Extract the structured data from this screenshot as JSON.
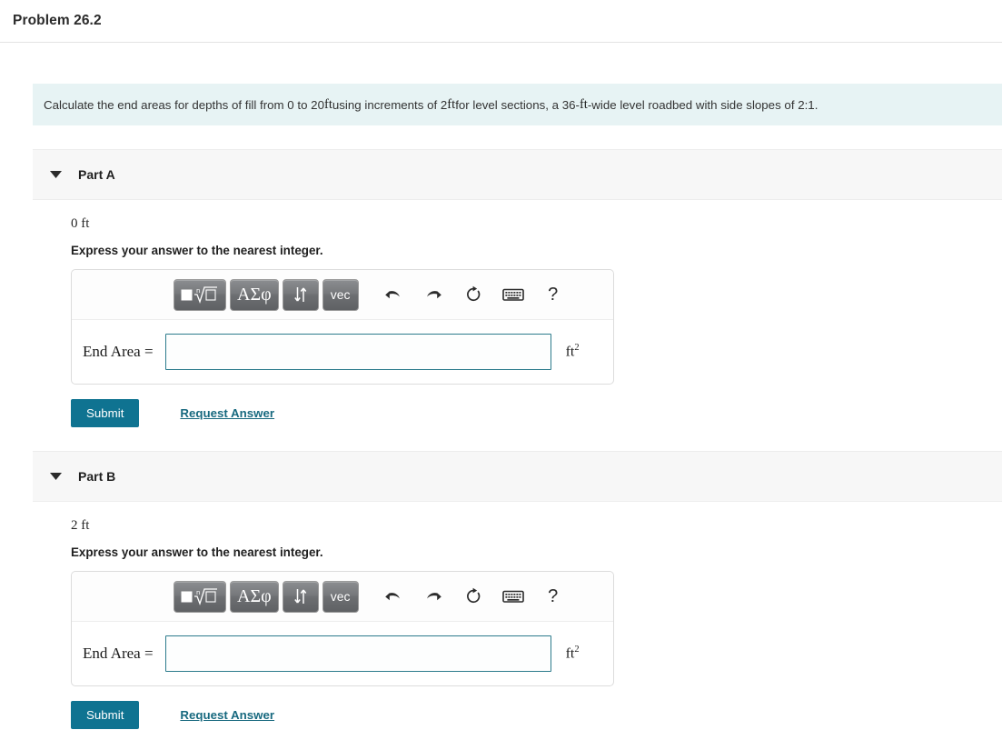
{
  "header": {
    "title": "Problem 26.2"
  },
  "statement": {
    "seg1": "Calculate the end areas for depths of fill from 0 to 20 ",
    "unit1": "ft",
    "seg2": " using increments of 2 ",
    "unit2": "ft",
    "seg3": " for level sections, a 36-",
    "unit3": "ft",
    "seg4": "-wide level roadbed with side slopes of 2:1."
  },
  "toolbar": {
    "template_button": "template-radical",
    "greek_label": "ΑΣφ",
    "arrows_label": "↕",
    "vec_label": "vec",
    "undo_icon": "undo-icon",
    "redo_icon": "redo-icon",
    "reset_icon": "reset-icon",
    "keyboard_icon": "keyboard-icon",
    "help_label": "?"
  },
  "answer": {
    "equation_label": "End Area =",
    "input_value": "",
    "input_placeholder": "",
    "unit_base": "ft",
    "unit_exp": "2"
  },
  "actions": {
    "submit_label": "Submit",
    "request_label": "Request Answer"
  },
  "parts": [
    {
      "label": "Part A",
      "caret": "caret-down-icon",
      "depth": "0 ft",
      "instruction": "Express your answer to the nearest integer."
    },
    {
      "label": "Part B",
      "caret": "caret-down-icon",
      "depth": "2 ft",
      "instruction": "Express your answer to the nearest integer."
    }
  ],
  "colors": {
    "banner_bg": "#e7f3f4",
    "part_bg": "#f7f7f7",
    "accent": "#0f7391",
    "link": "#17697f",
    "input_border": "#2c7b8c"
  }
}
